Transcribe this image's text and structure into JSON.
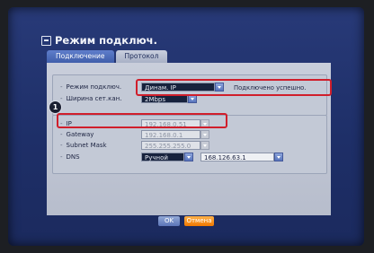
{
  "window": {
    "title": "Режим подключ."
  },
  "tabs": [
    {
      "label": "Подключение",
      "active": true
    },
    {
      "label": "Протокол",
      "active": false
    }
  ],
  "connection": {
    "mode_label": "Режим подключ.",
    "mode_value": "Динам. IP",
    "status": "Подключено успешно.",
    "bandwidth_label": "Ширина сет.кан.",
    "bandwidth_value": "2Mbps"
  },
  "network": {
    "ip_label": "IP",
    "ip_value": "192.168.0.51",
    "gateway_label": "Gateway",
    "gateway_value": "192.168.0.1",
    "subnet_label": "Subnet Mask",
    "subnet_value": "255.255.255.0",
    "dns_label": "DNS",
    "dns_mode": "Ручной",
    "dns_value": "168.126.63.1"
  },
  "callout": {
    "number": "1"
  },
  "buttons": {
    "ok": "OK",
    "cancel": "Отмена"
  },
  "colors": {
    "highlight": "#d01e2b",
    "cancel_button": "#f07800",
    "screen": "#243672"
  }
}
